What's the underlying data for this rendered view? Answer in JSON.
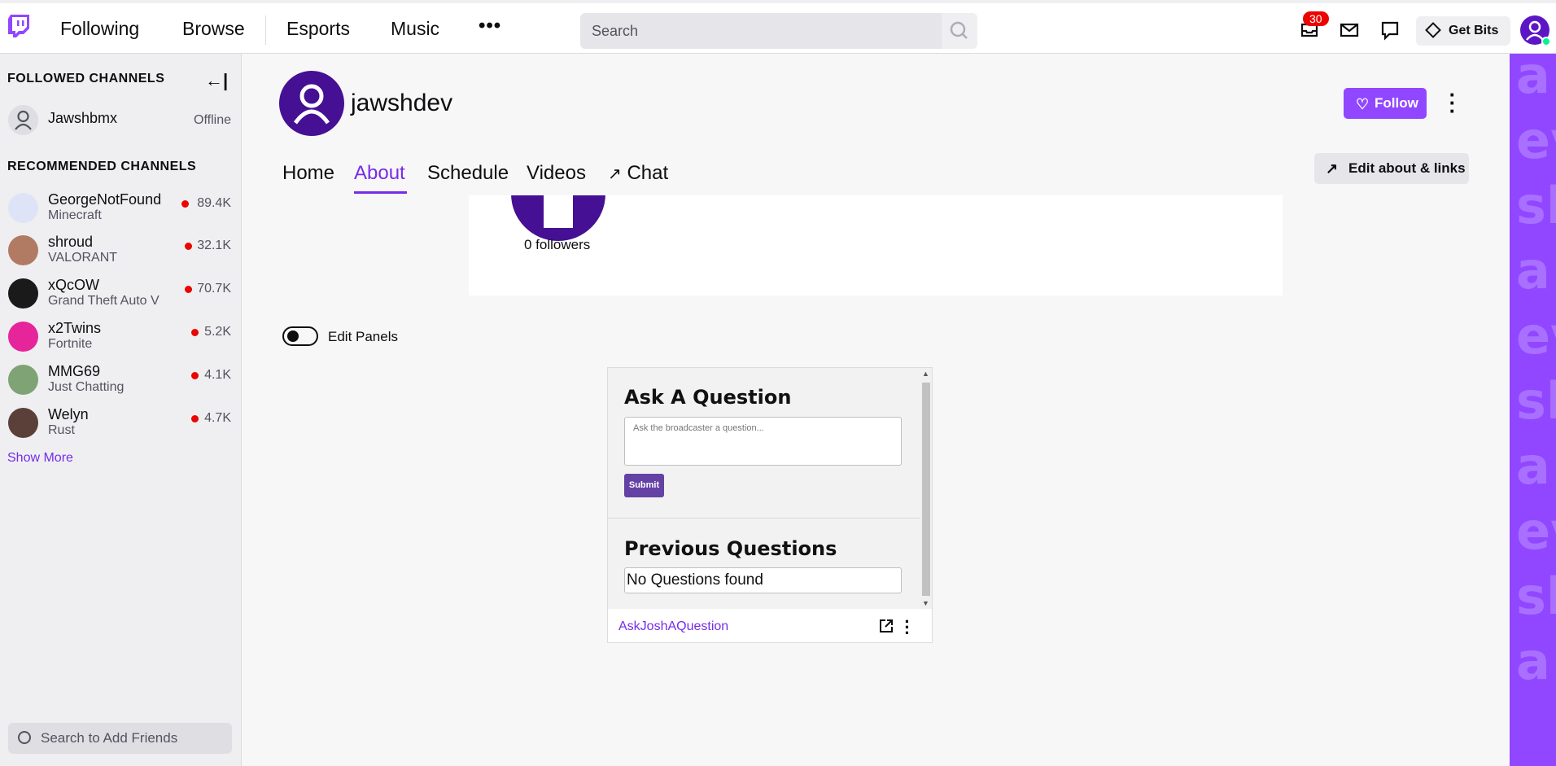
{
  "topnav": {
    "links": [
      "Following",
      "Browse",
      "Esports",
      "Music"
    ],
    "more_label": "•••",
    "search_placeholder": "Search",
    "notification_count": "30",
    "get_bits_label": "Get Bits"
  },
  "sidebar": {
    "followed_heading": "FOLLOWED CHANNELS",
    "collapse_label": "←|",
    "followed": [
      {
        "name": "Jawshbmx",
        "status": "Offline"
      }
    ],
    "recommended_heading": "RECOMMENDED CHANNELS",
    "recommended": [
      {
        "name": "GeorgeNotFound",
        "game": "Minecraft",
        "viewers": "89.4K"
      },
      {
        "name": "shroud",
        "game": "VALORANT",
        "viewers": "32.1K"
      },
      {
        "name": "xQcOW",
        "game": "Grand Theft Auto V",
        "viewers": "70.7K"
      },
      {
        "name": "x2Twins",
        "game": "Fortnite",
        "viewers": "5.2K"
      },
      {
        "name": "MMG69",
        "game": "Just Chatting",
        "viewers": "4.1K"
      },
      {
        "name": "Welyn",
        "game": "Rust",
        "viewers": "4.7K"
      }
    ],
    "show_more": "Show More",
    "friend_search_placeholder": "Search to Add Friends"
  },
  "channel": {
    "name": "jawshdev",
    "follow_label": "Follow",
    "tabs": [
      "Home",
      "About",
      "Schedule",
      "Videos",
      "Chat"
    ],
    "active_tab": "About",
    "edit_about_label": "Edit about & links",
    "followers_text": "0 followers",
    "edit_panels_label": "Edit Panels"
  },
  "panel": {
    "ask_title": "Ask A Question",
    "ask_placeholder": "Ask the broadcaster a question...",
    "submit_label": "Submit",
    "previous_title": "Previous Questions",
    "no_questions": "No Questions found",
    "extension_name": "AskJoshAQuestion"
  },
  "colors": {
    "brand_purple": "#9147ff",
    "accent_purple": "#772ce8",
    "live_red": "#eb0400"
  },
  "strip_words": [
    "a",
    "ev",
    "sh",
    "a",
    "ev",
    "sh",
    "a",
    "ev",
    "sh",
    "a"
  ]
}
